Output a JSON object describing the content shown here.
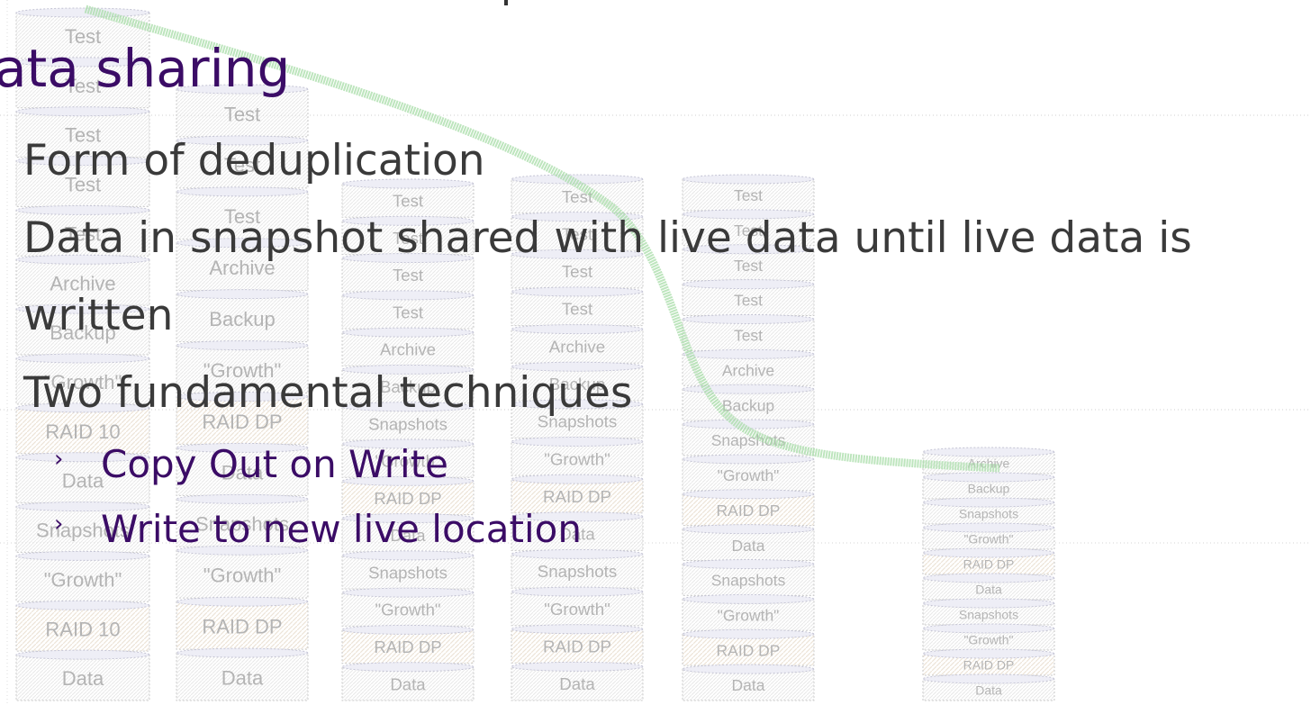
{
  "slide": {
    "title": "ata sharing",
    "bullets": [
      "Form of deduplication",
      "Data in snapshot shared with live data until live data is written",
      "Two fundamental techniques"
    ],
    "sub_bullets": [
      "Copy Out on Write",
      "Write to new live location"
    ],
    "sub_bullet_marker": "›"
  },
  "background": {
    "columns": [
      {
        "labels": [
          "Test",
          "Test",
          "Test",
          "Test",
          "Test",
          "Archive",
          "Backup",
          "\"Growth\"",
          "RAID 10",
          "Data",
          "Snapshots",
          "\"Growth\"",
          "RAID 10",
          "Data"
        ]
      },
      {
        "labels": [
          "Test",
          "Test",
          "Test",
          "Archive",
          "Backup",
          "\"Growth\"",
          "RAID DP",
          "Data",
          "Snapshots",
          "\"Growth\"",
          "RAID DP",
          "Data"
        ]
      },
      {
        "labels": [
          "Test",
          "Test",
          "Test",
          "Test",
          "Archive",
          "Backup",
          "Snapshots",
          "\"Growth\"",
          "RAID DP",
          "Data",
          "Snapshots",
          "\"Growth\"",
          "RAID DP",
          "Data"
        ]
      },
      {
        "labels": [
          "Test",
          "Test",
          "Test",
          "Test",
          "Archive",
          "Backup",
          "Snapshots",
          "\"Growth\"",
          "RAID DP",
          "Data",
          "Snapshots",
          "\"Growth\"",
          "RAID DP",
          "Data"
        ]
      },
      {
        "labels": [
          "Test",
          "Test",
          "Test",
          "Test",
          "Test",
          "Archive",
          "Backup",
          "Snapshots",
          "\"Growth\"",
          "RAID DP",
          "Data",
          "Snapshots",
          "\"Growth\"",
          "RAID DP",
          "Data"
        ]
      },
      {
        "labels": [
          "Archive",
          "Backup",
          "Snapshots",
          "\"Growth\"",
          "RAID DP",
          "Data",
          "Snapshots",
          "\"Growth\"",
          "RAID DP",
          "Data"
        ]
      }
    ],
    "colors": {
      "title": "#3b0c66",
      "body_text": "#3a3a3a",
      "trend_line": "#9fd79f",
      "cylinder_outline": "#c8c8c8",
      "cylinder_label": "#b4b4b4"
    }
  }
}
